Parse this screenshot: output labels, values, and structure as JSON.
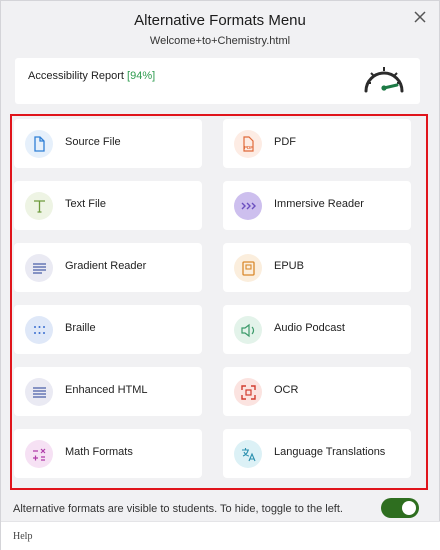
{
  "header": {
    "title": "Alternative Formats Menu",
    "filename": "Welcome+to+Chemistry.html"
  },
  "report": {
    "label": "Accessibility Report",
    "percent": "[94%]",
    "score_fraction": 0.94
  },
  "formats": [
    {
      "label": "Source File",
      "icon": "document-icon",
      "color": "#2f7fd6",
      "bg": "#e6f0fb"
    },
    {
      "label": "PDF",
      "icon": "pdf-icon",
      "color": "#e06a3a",
      "bg": "#fdece4"
    },
    {
      "label": "Text File",
      "icon": "text-t-icon",
      "color": "#6e9a3c",
      "bg": "#eef4e4"
    },
    {
      "label": "Immersive Reader",
      "icon": "chevrons-right-icon",
      "color": "#6b4fbf",
      "bg": "#cdbfee"
    },
    {
      "label": "Gradient Reader",
      "icon": "gradient-lines-icon",
      "color": "#4a5fa8",
      "bg": "#eaeaf3"
    },
    {
      "label": "EPUB",
      "icon": "book-icon",
      "color": "#d9892b",
      "bg": "#fbeedd"
    },
    {
      "label": "Braille",
      "icon": "braille-dots-icon",
      "color": "#3a6fd0",
      "bg": "#dfe8f8"
    },
    {
      "label": "Audio Podcast",
      "icon": "speaker-icon",
      "color": "#3b9a6a",
      "bg": "#e3f3ea"
    },
    {
      "label": "Enhanced HTML",
      "icon": "enhanced-lines-icon",
      "color": "#4a5fa8",
      "bg": "#eaeaf3"
    },
    {
      "label": "OCR",
      "icon": "ocr-scan-icon",
      "color": "#d13d2f",
      "bg": "#fbe3e0"
    },
    {
      "label": "Math Formats",
      "icon": "math-symbols-icon",
      "color": "#b03aa8",
      "bg": "#f6e1f4"
    },
    {
      "label": "Language Translations",
      "icon": "translate-icon",
      "color": "#2a8fae",
      "bg": "#dcf1f6"
    }
  ],
  "footer": {
    "note": "Alternative formats are visible to students. To hide, toggle to the left.",
    "toggle_on": true,
    "help": "Help"
  },
  "colors": {
    "highlight_border": "#e0141b",
    "toggle_on": "#2e6e1f",
    "percent_green": "#2e9c4f"
  }
}
